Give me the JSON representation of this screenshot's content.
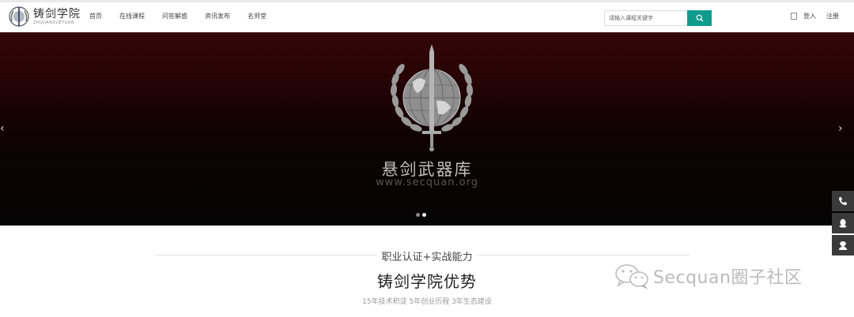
{
  "header": {
    "logo": {
      "title": "铸剑学院",
      "subtitle": "ZHUJIANXUEYUAN"
    },
    "nav": [
      {
        "label": "首页"
      },
      {
        "label": "在线课程"
      },
      {
        "label": "问答解惑"
      },
      {
        "label": "资讯发布"
      },
      {
        "label": "名师堂"
      }
    ],
    "search": {
      "placeholder": "请输入课程关键字",
      "button_icon": "search-icon"
    },
    "auth": {
      "login": "登入",
      "register": "注册"
    }
  },
  "banner": {
    "title": "悬剑武器库",
    "url": "www.secquan.org",
    "slides_total": 2,
    "active_slide": 2,
    "prev_icon": "chevron-left-icon",
    "next_icon": "chevron-right-icon"
  },
  "sidebar": {
    "buttons": [
      {
        "icon": "phone-icon"
      },
      {
        "icon": "qq-icon"
      },
      {
        "icon": "support-agent-icon"
      }
    ]
  },
  "section": {
    "subtitle": "职业认证+实战能力",
    "title": "铸剑学院优势",
    "description": "15年技术积淀 5年创业历程 3年生态建设"
  },
  "watermark": {
    "text": "Secquan圈子社区"
  },
  "colors": {
    "accent": "#0f9c8f",
    "banner_red": "#3a0608",
    "sidebar": "#3a3a3a"
  }
}
